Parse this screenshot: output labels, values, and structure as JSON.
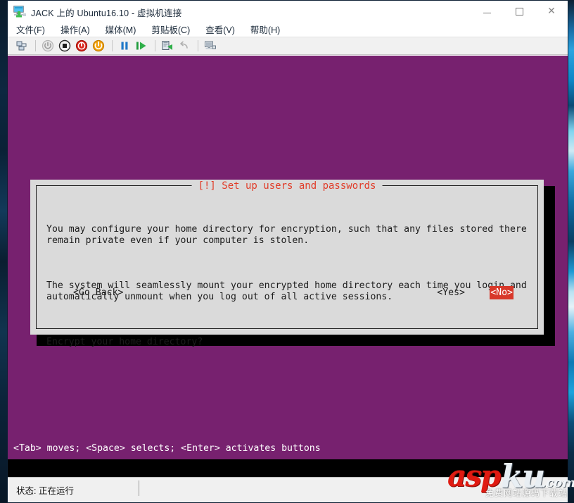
{
  "window": {
    "title": "JACK 上的 Ubuntu16.10 - 虚拟机连接",
    "icon": "vm-monitor-icon",
    "controls": {
      "minimize": "—",
      "maximize": "□",
      "close": "✕"
    }
  },
  "menubar": {
    "items": [
      {
        "label": "文件(F)",
        "name": "menu-file"
      },
      {
        "label": "操作(A)",
        "name": "menu-action"
      },
      {
        "label": "媒体(M)",
        "name": "menu-media"
      },
      {
        "label": "剪贴板(C)",
        "name": "menu-clipboard"
      },
      {
        "label": "查看(V)",
        "name": "menu-view"
      },
      {
        "label": "帮助(H)",
        "name": "menu-help"
      }
    ]
  },
  "toolbar": {
    "buttons": [
      {
        "name": "ctrl-alt-del-icon",
        "title": "Ctrl+Alt+Del"
      },
      {
        "name": "power-off-icon",
        "title": "关机"
      },
      {
        "name": "shutdown-icon",
        "title": "停止"
      },
      {
        "name": "turn-off-icon",
        "title": "关闭"
      },
      {
        "name": "start-icon",
        "title": "启动"
      },
      {
        "name": "pause-icon",
        "title": "暂停"
      },
      {
        "name": "resume-icon",
        "title": "继续"
      },
      {
        "name": "checkpoint-icon",
        "title": "检查点"
      },
      {
        "name": "revert-icon",
        "title": "还原"
      },
      {
        "name": "enhanced-session-icon",
        "title": "增强会话"
      }
    ]
  },
  "vm": {
    "background_color": "#77216f",
    "dialog": {
      "title": "[!] Set up users and passwords",
      "title_color": "#e13c28",
      "paragraphs": [
        "You may configure your home directory for encryption, such that any files stored there\nremain private even if your computer is stolen.",
        "The system will seamlessly mount your encrypted home directory each time you login and\nautomatically unmount when you log out of all active sessions.",
        "Encrypt your home directory?"
      ],
      "buttons": {
        "go_back": "<Go Back>",
        "yes": "<Yes>",
        "no": "<No>",
        "selected": "<No>",
        "selected_bg": "#d8382a",
        "selected_fg": "#ffffff"
      }
    },
    "hint": "<Tab> moves; <Space> selects; <Enter> activates buttons"
  },
  "statusbar": {
    "label": "状态: 正在运行"
  },
  "watermark": {
    "part1": "asp",
    "part2": "ku",
    "part3": ".com",
    "subtitle": "免费网站源码下载站"
  }
}
